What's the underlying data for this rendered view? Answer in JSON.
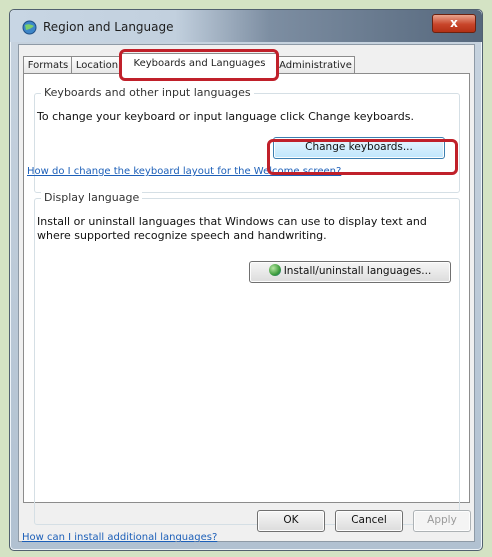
{
  "window": {
    "title": "Region and Language",
    "close_label": "x"
  },
  "tabs": [
    {
      "label": "Formats"
    },
    {
      "label": "Location"
    },
    {
      "label": "Keyboards and Languages",
      "active": true
    },
    {
      "label": "Administrative"
    }
  ],
  "keyboards_group": {
    "legend": "Keyboards and other input languages",
    "description": "To change your keyboard or input language click Change keyboards.",
    "change_keyboards_button": "Change keyboards...",
    "help_link": "How do I change the keyboard layout for the Welcome screen?"
  },
  "display_group": {
    "legend": "Display language",
    "description": "Install or uninstall languages that Windows can use to display text and where supported recognize speech and handwriting.",
    "install_button": "Install/uninstall languages..."
  },
  "bottom_link": "How can I install additional languages?",
  "footer": {
    "ok": "OK",
    "cancel": "Cancel",
    "apply": "Apply"
  },
  "colors": {
    "highlight": "#c0202a",
    "link": "#1c5fb8"
  },
  "icons": {
    "app": "region-language-globe-icon",
    "install": "shield-globe-icon"
  }
}
